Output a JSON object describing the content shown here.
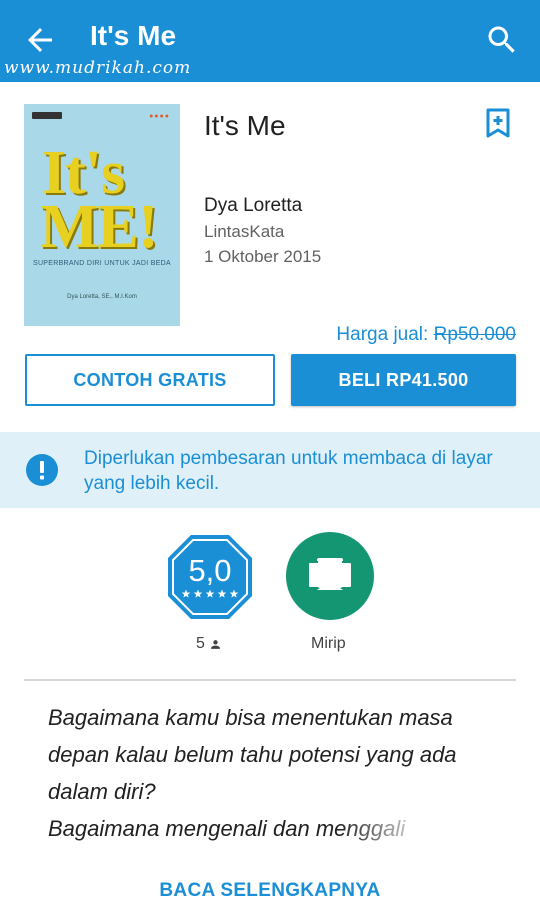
{
  "appbar": {
    "title": "It's Me",
    "watermark": "www.mudrikah.com"
  },
  "book": {
    "cover": {
      "line1": "It's",
      "line2": "ME!",
      "subtitle": "SUPERBRAND DIRI UNTUK JADI BEDA",
      "author_line": "Dya Loretta, SE., M.I.Kom"
    },
    "title": "It's Me",
    "author": "Dya Loretta",
    "publisher": "LintasKata",
    "date": "1 Oktober 2015"
  },
  "price": {
    "label": "Harga jual:",
    "original": "Rp50.000"
  },
  "buttons": {
    "sample": "CONTOH GRATIS",
    "buy": "BELI RP41.500"
  },
  "notice": {
    "text": "Diperlukan pembesaran untuk membaca di layar yang lebih kecil."
  },
  "rating": {
    "value": "5,0",
    "count": "5",
    "stars": 5
  },
  "similar": {
    "label": "Mirip"
  },
  "description": {
    "line1": "Bagaimana kamu bisa menentukan masa",
    "line2": "depan kalau belum tahu potensi yang ada",
    "line3": "dalam diri?",
    "line4": "Bagaimana mengenali dan menggali"
  },
  "read_more": "BACA SELENGKAPNYA",
  "colors": {
    "primary": "#1a8fd6",
    "notice_bg": "#dff0f8",
    "similar": "#149672"
  }
}
